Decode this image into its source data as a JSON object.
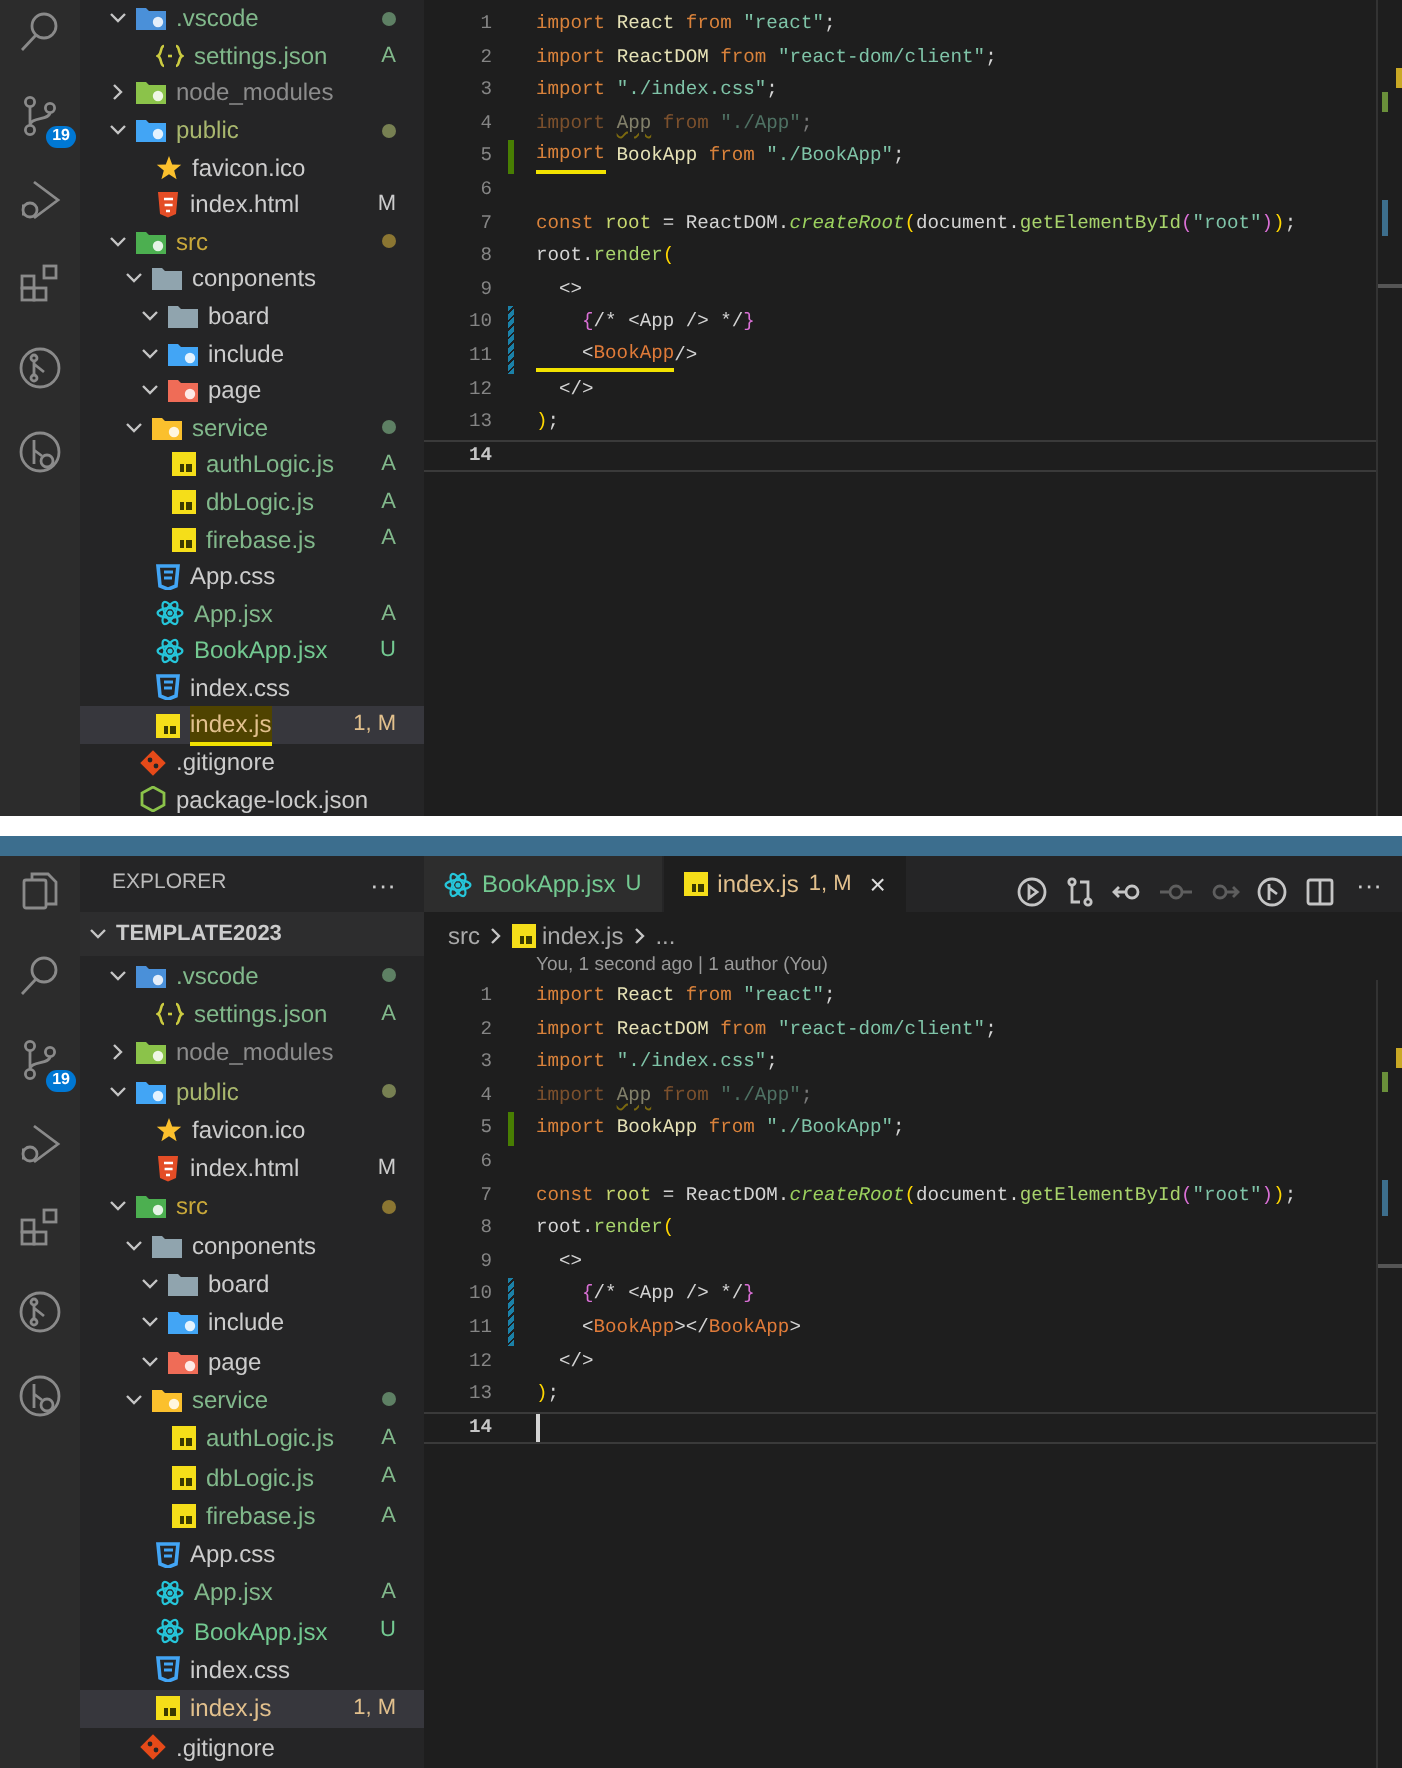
{
  "panels": [
    {
      "activity_bar": [
        {
          "kind": "search"
        },
        {
          "kind": "source-control",
          "badge": "19"
        },
        {
          "kind": "run"
        },
        {
          "kind": "extensions"
        },
        {
          "kind": "git-graph"
        },
        {
          "kind": "remote"
        }
      ],
      "explorer": {
        "tree": [
          {
            "name": ".vscode",
            "kind": "vscode",
            "color": "#81b88b",
            "dot": true,
            "expanded": true,
            "selected": false,
            "children": [
              {
                "name": "settings.json",
                "kind": "json",
                "color": "#81b88b",
                "badge": "A",
                "selected": false
              }
            ]
          },
          {
            "name": "node_modules",
            "kind": "modules",
            "color": "#8c8c8c",
            "expanded": false,
            "selected": false
          },
          {
            "name": "public",
            "kind": "public",
            "color": "#a9b76e",
            "dot": true,
            "expanded": true,
            "selected": false,
            "children": [
              {
                "name": "favicon.ico",
                "kind": "star",
                "color": "#cccccc",
                "selected": false
              },
              {
                "name": "index.html",
                "kind": "html",
                "color": "#cccccc",
                "badge": "M",
                "selected": false
              }
            ]
          },
          {
            "name": "src",
            "kind": "src",
            "color": "#c9a83a",
            "dot": true,
            "expanded": true,
            "selected": false,
            "children": [
              {
                "name": "conponents",
                "kind": "folder",
                "color": "#cccccc",
                "expanded": true,
                "selected": false,
                "children": [
                  {
                    "name": "board",
                    "kind": "folder",
                    "color": "#cccccc",
                    "expanded": true,
                    "selected": false
                  },
                  {
                    "name": "include",
                    "kind": "include",
                    "color": "#cccccc",
                    "expanded": true,
                    "selected": false
                  },
                  {
                    "name": "page",
                    "kind": "page",
                    "color": "#cccccc",
                    "expanded": true,
                    "selected": false
                  }
                ]
              },
              {
                "name": "service",
                "kind": "service",
                "color": "#81b88b",
                "dot": true,
                "expanded": true,
                "selected": false,
                "children": [
                  {
                    "name": "authLogic.js",
                    "kind": "js",
                    "color": "#81b88b",
                    "badge": "A",
                    "selected": false
                  },
                  {
                    "name": "dbLogic.js",
                    "kind": "js",
                    "color": "#81b88b",
                    "badge": "A",
                    "selected": false
                  },
                  {
                    "name": "firebase.js",
                    "kind": "js",
                    "color": "#81b88b",
                    "badge": "A",
                    "selected": false
                  }
                ]
              },
              {
                "name": "App.css",
                "kind": "css",
                "color": "#cccccc",
                "selected": false
              },
              {
                "name": "App.jsx",
                "kind": "react",
                "color": "#81b88b",
                "badge": "A",
                "selected": false
              },
              {
                "name": "BookApp.jsx",
                "kind": "react",
                "color": "#73c991",
                "badge": "U",
                "selected": false
              },
              {
                "name": "index.css",
                "kind": "css",
                "color": "#cccccc",
                "selected": false
              },
              {
                "name": "index.js",
                "kind": "js",
                "color": "#e2c08d",
                "badge": "1, M",
                "selected": true,
                "marked": true
              }
            ]
          },
          {
            "name": ".gitignore",
            "kind": "git",
            "color": "#cccccc",
            "selected": false
          },
          {
            "name": "package-lock.json",
            "kind": "npm",
            "color": "#cccccc",
            "selected": false
          }
        ]
      },
      "code": [
        {
          "number": "1",
          "tokens": [
            {
              "text": "import ",
              "kind": "kw"
            },
            {
              "text": "React ",
              "kind": "id"
            },
            {
              "text": "from ",
              "kind": "kw"
            },
            {
              "text": "\"react\"",
              "kind": "str"
            },
            {
              "text": ";",
              "kind": "p"
            }
          ]
        },
        {
          "number": "2",
          "tokens": [
            {
              "text": "import ",
              "kind": "kw"
            },
            {
              "text": "ReactDOM ",
              "kind": "id"
            },
            {
              "text": "from ",
              "kind": "kw"
            },
            {
              "text": "\"react-dom/client\"",
              "kind": "str"
            },
            {
              "text": ";",
              "kind": "p"
            }
          ]
        },
        {
          "number": "3",
          "tokens": [
            {
              "text": "import ",
              "kind": "kw"
            },
            {
              "text": "\"./index.css\"",
              "kind": "str"
            },
            {
              "text": ";",
              "kind": "p"
            }
          ]
        },
        {
          "number": "4",
          "faded": true,
          "tokens": [
            {
              "text": "import ",
              "kind": "kw"
            },
            {
              "text": "App",
              "kind": "id",
              "squiggle": true
            },
            {
              "text": " from ",
              "kind": "kw"
            },
            {
              "text": "\"./App\"",
              "kind": "str"
            },
            {
              "text": ";",
              "kind": "p"
            }
          ]
        },
        {
          "number": "5",
          "added": true,
          "tokens": [
            {
              "text": "import",
              "kind": "kw",
              "marked": true
            },
            {
              "text": " BookApp ",
              "kind": "id"
            },
            {
              "text": "from ",
              "kind": "kw"
            },
            {
              "text": "\"./BookApp\"",
              "kind": "str"
            },
            {
              "text": ";",
              "kind": "p"
            }
          ]
        },
        {
          "number": "6"
        },
        {
          "number": "7",
          "tokens": [
            {
              "text": "const ",
              "kind": "kw"
            },
            {
              "text": "root ",
              "kind": "var"
            },
            {
              "text": "= ReactDOM.",
              "kind": "p"
            },
            {
              "text": "createRoot",
              "kind": "fni"
            },
            {
              "text": "(",
              "kind": "b1"
            },
            {
              "text": "document.",
              "kind": "p"
            },
            {
              "text": "getElementById",
              "kind": "fn"
            },
            {
              "text": "(",
              "kind": "b2"
            },
            {
              "text": "\"root\"",
              "kind": "str"
            },
            {
              "text": ")",
              "kind": "b2"
            },
            {
              "text": ")",
              "kind": "b1"
            },
            {
              "text": ";",
              "kind": "p"
            }
          ]
        },
        {
          "number": "8",
          "tokens": [
            {
              "text": "root.",
              "kind": "p"
            },
            {
              "text": "render",
              "kind": "fn"
            },
            {
              "text": "(",
              "kind": "b1"
            }
          ]
        },
        {
          "number": "9",
          "tokens": [
            {
              "text": "  <>",
              "kind": "p"
            }
          ]
        },
        {
          "number": "10",
          "modified": true,
          "tokens": [
            {
              "text": "    {",
              "kind": "b2"
            },
            {
              "text": "/* <App /> */",
              "kind": "p"
            },
            {
              "text": "}",
              "kind": "b2"
            }
          ]
        },
        {
          "number": "11",
          "modified": true,
          "tokens": [
            {
              "text": "    <",
              "kind": "p",
              "marked": true
            },
            {
              "text": "BookApp",
              "kind": "tag",
              "marked": true
            },
            {
              "text": "/>",
              "kind": "p"
            }
          ]
        },
        {
          "number": "12",
          "tokens": [
            {
              "text": "  </>",
              "kind": "p"
            }
          ]
        },
        {
          "number": "13",
          "tokens": [
            {
              "text": ")",
              "kind": "b1"
            },
            {
              "text": ";",
              "kind": "p"
            }
          ]
        },
        {
          "number": "14",
          "current": true
        }
      ]
    },
    {
      "activity_bar": [
        {
          "kind": "files"
        },
        {
          "kind": "search"
        },
        {
          "kind": "source-control",
          "badge": "19"
        },
        {
          "kind": "run"
        },
        {
          "kind": "extensions"
        },
        {
          "kind": "git-graph"
        },
        {
          "kind": "remote"
        }
      ],
      "explorer": {
        "title": "EXPLORER",
        "more": "···",
        "workspace": "TEMPLATE2023",
        "tree": [
          {
            "name": ".vscode",
            "kind": "vscode",
            "color": "#81b88b",
            "dot": true,
            "expanded": true,
            "selected": false,
            "children": [
              {
                "name": "settings.json",
                "kind": "json",
                "color": "#81b88b",
                "badge": "A",
                "selected": false
              }
            ]
          },
          {
            "name": "node_modules",
            "kind": "modules",
            "color": "#8c8c8c",
            "expanded": false,
            "selected": false
          },
          {
            "name": "public",
            "kind": "public",
            "color": "#a9b76e",
            "dot": true,
            "expanded": true,
            "selected": false,
            "children": [
              {
                "name": "favicon.ico",
                "kind": "star",
                "color": "#cccccc",
                "selected": false
              },
              {
                "name": "index.html",
                "kind": "html",
                "color": "#cccccc",
                "badge": "M",
                "selected": false
              }
            ]
          },
          {
            "name": "src",
            "kind": "src",
            "color": "#c9a83a",
            "dot": true,
            "expanded": true,
            "selected": false,
            "children": [
              {
                "name": "conponents",
                "kind": "folder",
                "color": "#cccccc",
                "expanded": true,
                "selected": false,
                "children": [
                  {
                    "name": "board",
                    "kind": "folder",
                    "color": "#cccccc",
                    "expanded": true,
                    "selected": false
                  },
                  {
                    "name": "include",
                    "kind": "include",
                    "color": "#cccccc",
                    "expanded": true,
                    "selected": false
                  },
                  {
                    "name": "page",
                    "kind": "page",
                    "color": "#cccccc",
                    "expanded": true,
                    "selected": false
                  }
                ]
              },
              {
                "name": "service",
                "kind": "service",
                "color": "#81b88b",
                "dot": true,
                "expanded": true,
                "selected": false,
                "children": [
                  {
                    "name": "authLogic.js",
                    "kind": "js",
                    "color": "#81b88b",
                    "badge": "A",
                    "selected": false
                  },
                  {
                    "name": "dbLogic.js",
                    "kind": "js",
                    "color": "#81b88b",
                    "badge": "A",
                    "selected": false
                  },
                  {
                    "name": "firebase.js",
                    "kind": "js",
                    "color": "#81b88b",
                    "badge": "A",
                    "selected": false
                  }
                ]
              },
              {
                "name": "App.css",
                "kind": "css",
                "color": "#cccccc",
                "selected": false
              },
              {
                "name": "App.jsx",
                "kind": "react",
                "color": "#81b88b",
                "badge": "A",
                "selected": false
              },
              {
                "name": "BookApp.jsx",
                "kind": "react",
                "color": "#73c991",
                "badge": "U",
                "selected": false
              },
              {
                "name": "index.css",
                "kind": "css",
                "color": "#cccccc",
                "selected": false
              },
              {
                "name": "index.js",
                "kind": "js",
                "color": "#e2c08d",
                "badge": "1, M",
                "selected": true
              }
            ]
          },
          {
            "name": ".gitignore",
            "kind": "git",
            "color": "#cccccc",
            "selected": false
          }
        ]
      },
      "tabs": [
        {
          "label": "BookApp.jsx",
          "kind": "react",
          "color": "#73c991",
          "badge": "U",
          "selected": false
        },
        {
          "label": "index.js",
          "kind": "js",
          "color": "#e2c08d",
          "badge": "1, M",
          "selected": true,
          "close": "×"
        }
      ],
      "toolbar": [
        {
          "kind": "run",
          "disabled": false
        },
        {
          "kind": "compare",
          "disabled": false
        },
        {
          "kind": "back",
          "disabled": false
        },
        {
          "kind": "commit",
          "disabled": true
        },
        {
          "kind": "forward",
          "disabled": true
        },
        {
          "kind": "branch",
          "disabled": false
        },
        {
          "kind": "split",
          "disabled": false
        }
      ],
      "toolbar_more": "···",
      "breadcrumb": [
        {
          "label": "src"
        },
        {
          "label": "index.js",
          "kind": "js"
        },
        {
          "label": "..."
        }
      ],
      "codelens": "You, 1 second ago | 1 author (You)",
      "code": [
        {
          "number": "1",
          "tokens": [
            {
              "text": "import ",
              "kind": "kw"
            },
            {
              "text": "React ",
              "kind": "id"
            },
            {
              "text": "from ",
              "kind": "kw"
            },
            {
              "text": "\"react\"",
              "kind": "str"
            },
            {
              "text": ";",
              "kind": "p"
            }
          ]
        },
        {
          "number": "2",
          "tokens": [
            {
              "text": "import ",
              "kind": "kw"
            },
            {
              "text": "ReactDOM ",
              "kind": "id"
            },
            {
              "text": "from ",
              "kind": "kw"
            },
            {
              "text": "\"react-dom/client\"",
              "kind": "str"
            },
            {
              "text": ";",
              "kind": "p"
            }
          ]
        },
        {
          "number": "3",
          "tokens": [
            {
              "text": "import ",
              "kind": "kw"
            },
            {
              "text": "\"./index.css\"",
              "kind": "str"
            },
            {
              "text": ";",
              "kind": "p"
            }
          ]
        },
        {
          "number": "4",
          "faded": true,
          "tokens": [
            {
              "text": "import ",
              "kind": "kw"
            },
            {
              "text": "App",
              "kind": "id",
              "squiggle": true
            },
            {
              "text": " from ",
              "kind": "kw"
            },
            {
              "text": "\"./App\"",
              "kind": "str"
            },
            {
              "text": ";",
              "kind": "p"
            }
          ]
        },
        {
          "number": "5",
          "added": true,
          "tokens": [
            {
              "text": "import ",
              "kind": "kw"
            },
            {
              "text": "BookApp ",
              "kind": "id"
            },
            {
              "text": "from ",
              "kind": "kw"
            },
            {
              "text": "\"./BookApp\"",
              "kind": "str"
            },
            {
              "text": ";",
              "kind": "p"
            }
          ]
        },
        {
          "number": "6"
        },
        {
          "number": "7",
          "tokens": [
            {
              "text": "const ",
              "kind": "kw"
            },
            {
              "text": "root ",
              "kind": "var"
            },
            {
              "text": "= ReactDOM.",
              "kind": "p"
            },
            {
              "text": "createRoot",
              "kind": "fni"
            },
            {
              "text": "(",
              "kind": "b1"
            },
            {
              "text": "document.",
              "kind": "p"
            },
            {
              "text": "getElementById",
              "kind": "fn"
            },
            {
              "text": "(",
              "kind": "b2"
            },
            {
              "text": "\"root\"",
              "kind": "str"
            },
            {
              "text": ")",
              "kind": "b2"
            },
            {
              "text": ")",
              "kind": "b1"
            },
            {
              "text": ";",
              "kind": "p"
            }
          ]
        },
        {
          "number": "8",
          "tokens": [
            {
              "text": "root.",
              "kind": "p"
            },
            {
              "text": "render",
              "kind": "fn"
            },
            {
              "text": "(",
              "kind": "b1"
            }
          ]
        },
        {
          "number": "9",
          "tokens": [
            {
              "text": "  <>",
              "kind": "p"
            }
          ]
        },
        {
          "number": "10",
          "modified": true,
          "tokens": [
            {
              "text": "    {",
              "kind": "b2"
            },
            {
              "text": "/* <App /> */",
              "kind": "p"
            },
            {
              "text": "}",
              "kind": "b2"
            }
          ]
        },
        {
          "number": "11",
          "modified": true,
          "tokens": [
            {
              "text": "    <",
              "kind": "p"
            },
            {
              "text": "BookApp",
              "kind": "tag"
            },
            {
              "text": "></",
              "kind": "p"
            },
            {
              "text": "BookApp",
              "kind": "tag"
            },
            {
              "text": ">",
              "kind": "p"
            }
          ]
        },
        {
          "number": "12",
          "tokens": [
            {
              "text": "  </>",
              "kind": "p"
            }
          ]
        },
        {
          "number": "13",
          "tokens": [
            {
              "text": ")",
              "kind": "b1"
            },
            {
              "text": ";",
              "kind": "p"
            }
          ]
        },
        {
          "number": "14",
          "current": true,
          "cursor": true
        }
      ]
    }
  ]
}
